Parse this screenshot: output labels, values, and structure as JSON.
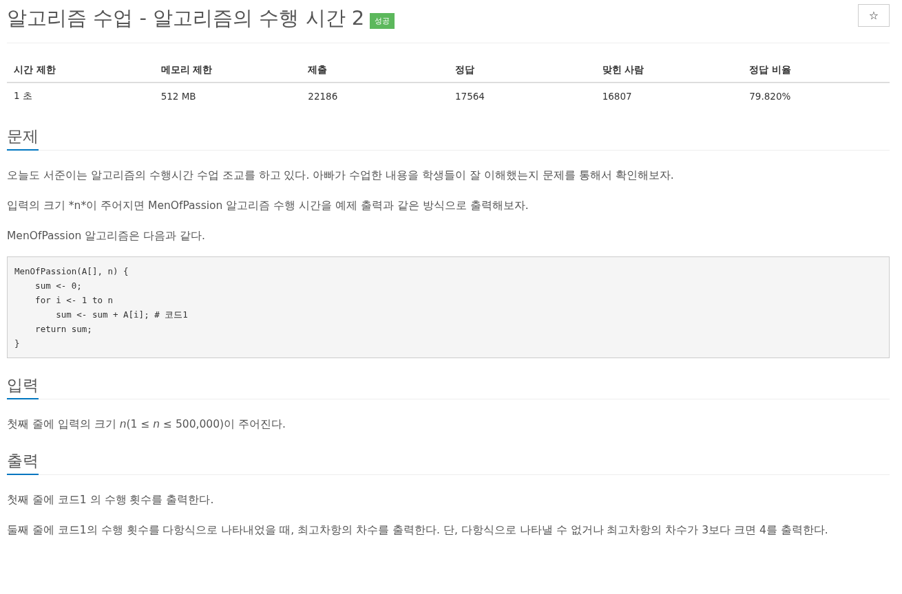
{
  "problem": {
    "title": "알고리즘 수업 - 알고리즘의 수행 시간 2",
    "status_badge": "성공",
    "star_button": "☆"
  },
  "stats": {
    "columns": [
      "시간 제한",
      "메모리 제한",
      "제출",
      "정답",
      "맞힌 사람",
      "정답 비율"
    ],
    "row": [
      "1 초",
      "512 MB",
      "22186",
      "17564",
      "16807",
      "79.820%"
    ]
  },
  "sections": [
    {
      "heading": "문제",
      "blocks": [
        {
          "kind": "text",
          "text": "오늘도 서준이는 알고리즘의 수행시간 수업 조교를 하고 있다. 아빠가 수업한 내용을 학생들이 잘 이해했는지 문제를 통해서 확인해보자."
        },
        {
          "kind": "text",
          "text": "입력의 크기 *n*이 주어지면 MenOfPassion 알고리즘 수행 시간을 예제 출력과 같은 방식으로 출력해보자."
        },
        {
          "kind": "text",
          "text": "MenOfPassion 알고리즘은 다음과 같다."
        },
        {
          "kind": "code",
          "text": "MenOfPassion(A[], n) {\n    sum <- 0;\n    for i <- 1 to n\n        sum <- sum + A[i]; # 코드1\n    return sum;\n}"
        }
      ]
    },
    {
      "heading": "입력",
      "blocks": [
        {
          "kind": "text",
          "text": "첫째 줄에 입력의 크기 *n*(1 ≤ *n* ≤ 500,000)이 주어진다."
        }
      ]
    },
    {
      "heading": "출력",
      "blocks": [
        {
          "kind": "text",
          "text": "첫째 줄에 코드1 의 수행 횟수를 출력한다."
        },
        {
          "kind": "text",
          "text": "둘째 줄에 코드1의 수행 횟수를 다항식으로 나타내었을 때, 최고차항의 차수를 출력한다. 단, 다항식으로 나타낼 수 없거나 최고차항의 차수가 3보다 크면 4를 출력한다."
        }
      ]
    }
  ]
}
